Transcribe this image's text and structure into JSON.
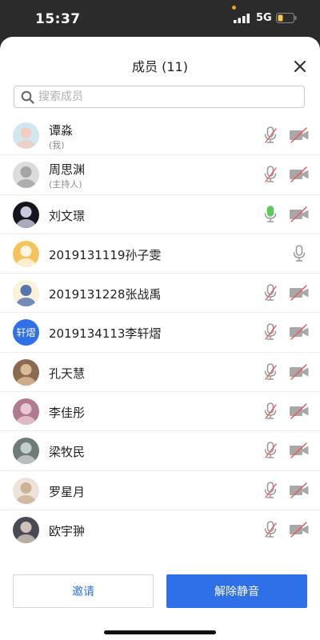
{
  "status_bar": {
    "time": "15:37",
    "network": "5G"
  },
  "sheet": {
    "title": "成员 (11)"
  },
  "search": {
    "placeholder": "搜索成员",
    "value": ""
  },
  "members": [
    {
      "name": "谭淼",
      "sub": "(我)",
      "mic": "muted",
      "camera": "off",
      "avatar": {
        "type": "image",
        "bg": "#cfe8f2",
        "fg": "#f6c9b8"
      }
    },
    {
      "name": "周思渊",
      "sub": "(主持人)",
      "mic": "muted",
      "camera": "off",
      "avatar": {
        "type": "image",
        "bg": "#dcdcdc",
        "fg": "#9a9a9a"
      }
    },
    {
      "name": "刘文璟",
      "sub": "",
      "mic": "active",
      "camera": "off",
      "avatar": {
        "type": "image",
        "bg": "#15151e",
        "fg": "#e9e9ff"
      }
    },
    {
      "name": "2019131119孙子雯",
      "sub": "",
      "mic": "unmuted",
      "camera": "none",
      "avatar": {
        "type": "image",
        "bg": "#f6c25a",
        "fg": "#ffffff"
      }
    },
    {
      "name": "2019131228张战禹",
      "sub": "",
      "mic": "muted",
      "camera": "off",
      "avatar": {
        "type": "image",
        "bg": "#f7f2d8",
        "fg": "#3a5fa8"
      }
    },
    {
      "name": "2019134113李轩熠",
      "sub": "",
      "mic": "muted",
      "camera": "off",
      "avatar": {
        "type": "text",
        "text": "轩熠",
        "bg": "#2f6fe8"
      }
    },
    {
      "name": "孔天慧",
      "sub": "",
      "mic": "muted",
      "camera": "off",
      "avatar": {
        "type": "image",
        "bg": "#8b6a4e",
        "fg": "#e8c9a8"
      }
    },
    {
      "name": "李佳彤",
      "sub": "",
      "mic": "muted",
      "camera": "off",
      "avatar": {
        "type": "image",
        "bg": "#b07a92",
        "fg": "#f3d6dc"
      }
    },
    {
      "name": "梁牧民",
      "sub": "",
      "mic": "muted",
      "camera": "off",
      "avatar": {
        "type": "image",
        "bg": "#6f7a7a",
        "fg": "#d5dcdc"
      }
    },
    {
      "name": "罗星月",
      "sub": "",
      "mic": "muted",
      "camera": "off",
      "avatar": {
        "type": "image",
        "bg": "#ece4da",
        "fg": "#c9a98a"
      }
    },
    {
      "name": "欧宇翀",
      "sub": "",
      "mic": "muted",
      "camera": "off",
      "avatar": {
        "type": "image",
        "bg": "#4a4a55",
        "fg": "#e7d6cc"
      }
    }
  ],
  "buttons": {
    "invite": "邀请",
    "unmute_all": "解除静音"
  },
  "colors": {
    "accent": "#2f6fe8",
    "mic_active": "#5cc95c",
    "muted_slash": "#e85a5a",
    "icon_gray": "#9a9a9a"
  }
}
